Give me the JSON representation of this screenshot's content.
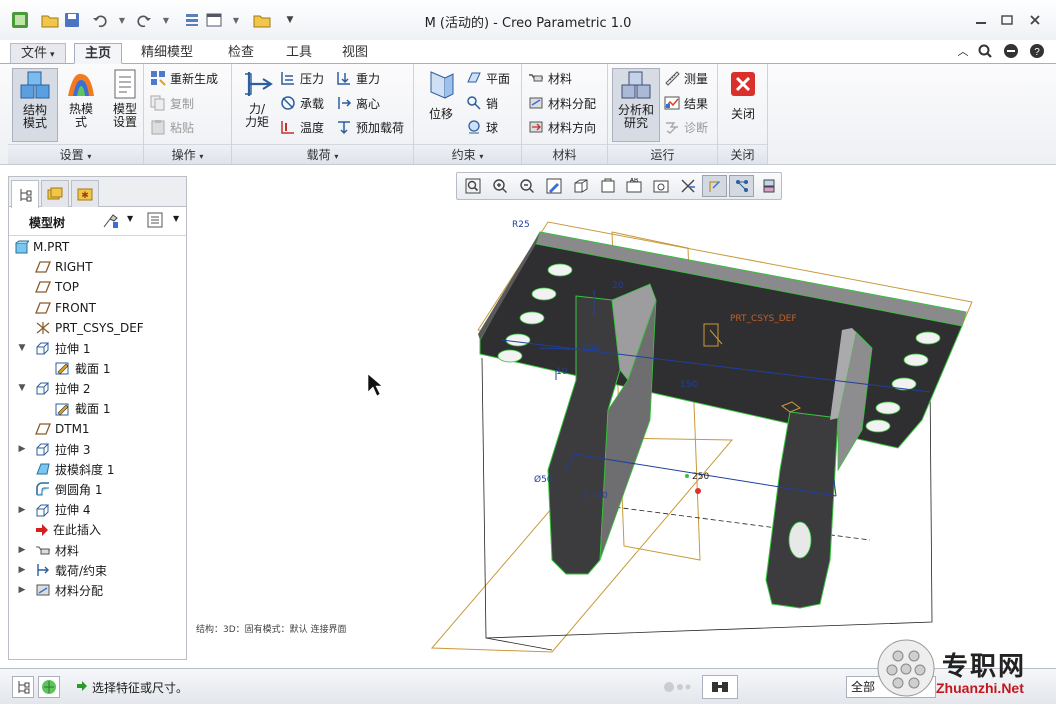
{
  "window": {
    "title": "M (活动的) - Creo Parametric 1.0"
  },
  "quick_access": {
    "icons": [
      "app-icon",
      "open-icon",
      "save-icon",
      "undo-icon",
      "redo-icon",
      "regenerate-icon",
      "window-icon",
      "close-window-icon",
      "customize-icon"
    ]
  },
  "tabs": [
    {
      "label": "文件",
      "dropdown": "▾"
    },
    {
      "label": "主页"
    },
    {
      "label": "精细模型"
    },
    {
      "label": "检查"
    },
    {
      "label": "工具"
    },
    {
      "label": "视图"
    }
  ],
  "ribbon": {
    "settings": {
      "group": "设置",
      "structure_mode": "结构\n模式",
      "thermal_mode": "热模\n式",
      "model_setup": "模型\n设置"
    },
    "operations": {
      "group": "操作",
      "regenerate": "重新生成",
      "copy": "复制",
      "paste": "粘贴"
    },
    "loads": {
      "group": "载荷",
      "force_moment": "力/\n力矩",
      "pressure": "压力",
      "bearing": "承载",
      "temperature": "温度",
      "gravity": "重力",
      "centrifugal": "离心",
      "preload": "预加载荷"
    },
    "constraints": {
      "group": "约束",
      "displacement": "位移",
      "planar": "平面",
      "pin": "销",
      "ball": "球"
    },
    "material": {
      "group": "材料",
      "material": "材料",
      "material_assignment": "材料分配",
      "material_orientation": "材料方向"
    },
    "run": {
      "group": "运行",
      "analyses_studies": "分析和\n研究",
      "measure": "测量",
      "results": "结果",
      "diagnostics": "诊断"
    },
    "close": {
      "group": "关闭",
      "close": "关闭"
    },
    "dropdown_arrow": "▾"
  },
  "model_tree": {
    "header": "模型树",
    "items": [
      {
        "label": "M.PRT",
        "icon": "part-icon"
      },
      {
        "label": "RIGHT",
        "icon": "datum-plane-icon"
      },
      {
        "label": "TOP",
        "icon": "datum-plane-icon"
      },
      {
        "label": "FRONT",
        "icon": "datum-plane-icon"
      },
      {
        "label": "PRT_CSYS_DEF",
        "icon": "csys-icon"
      },
      {
        "label": "拉伸 1",
        "icon": "extrude-icon",
        "expanded": true
      },
      {
        "label": "截面 1",
        "icon": "sketch-icon"
      },
      {
        "label": "拉伸 2",
        "icon": "extrude-icon",
        "expanded": true
      },
      {
        "label": "截面 1",
        "icon": "sketch-icon"
      },
      {
        "label": "DTM1",
        "icon": "datum-plane-icon"
      },
      {
        "label": "拉伸 3",
        "icon": "extrude-icon"
      },
      {
        "label": "拔模斜度 1",
        "icon": "draft-icon"
      },
      {
        "label": "倒圆角 1",
        "icon": "round-icon"
      },
      {
        "label": "拉伸 4",
        "icon": "extrude-icon"
      },
      {
        "label": "在此插入",
        "icon": "insert-here-icon"
      },
      {
        "label": "材料",
        "icon": "material-icon"
      },
      {
        "label": "载荷/约束",
        "icon": "loads-icon"
      },
      {
        "label": "材料分配",
        "icon": "material-assign-icon"
      }
    ]
  },
  "viewport": {
    "status_text": "结构：3D：固有模式：默认 连接界面",
    "annotations": {
      "radius": "R25",
      "csys": "PRT_CSYS_DEF",
      "dim_100": "100",
      "dim_150": "150",
      "dim_250": "250",
      "dim_50": "Ø50",
      "dim_2x100": "2.100",
      "dim_20": "20",
      "dim_10": "10"
    }
  },
  "status_bar": {
    "message": "选择特征或尺寸。",
    "filter": "全部"
  },
  "watermark": {
    "brand": "专职网",
    "url": "Zhuanzhi.Net"
  },
  "colors": {
    "accent_blue": "#1f3f9f",
    "model_dark": "#2e2e30",
    "datum_orange": "#c89a3a",
    "edge_green": "#35c43a",
    "close_red": "#d9302c"
  }
}
